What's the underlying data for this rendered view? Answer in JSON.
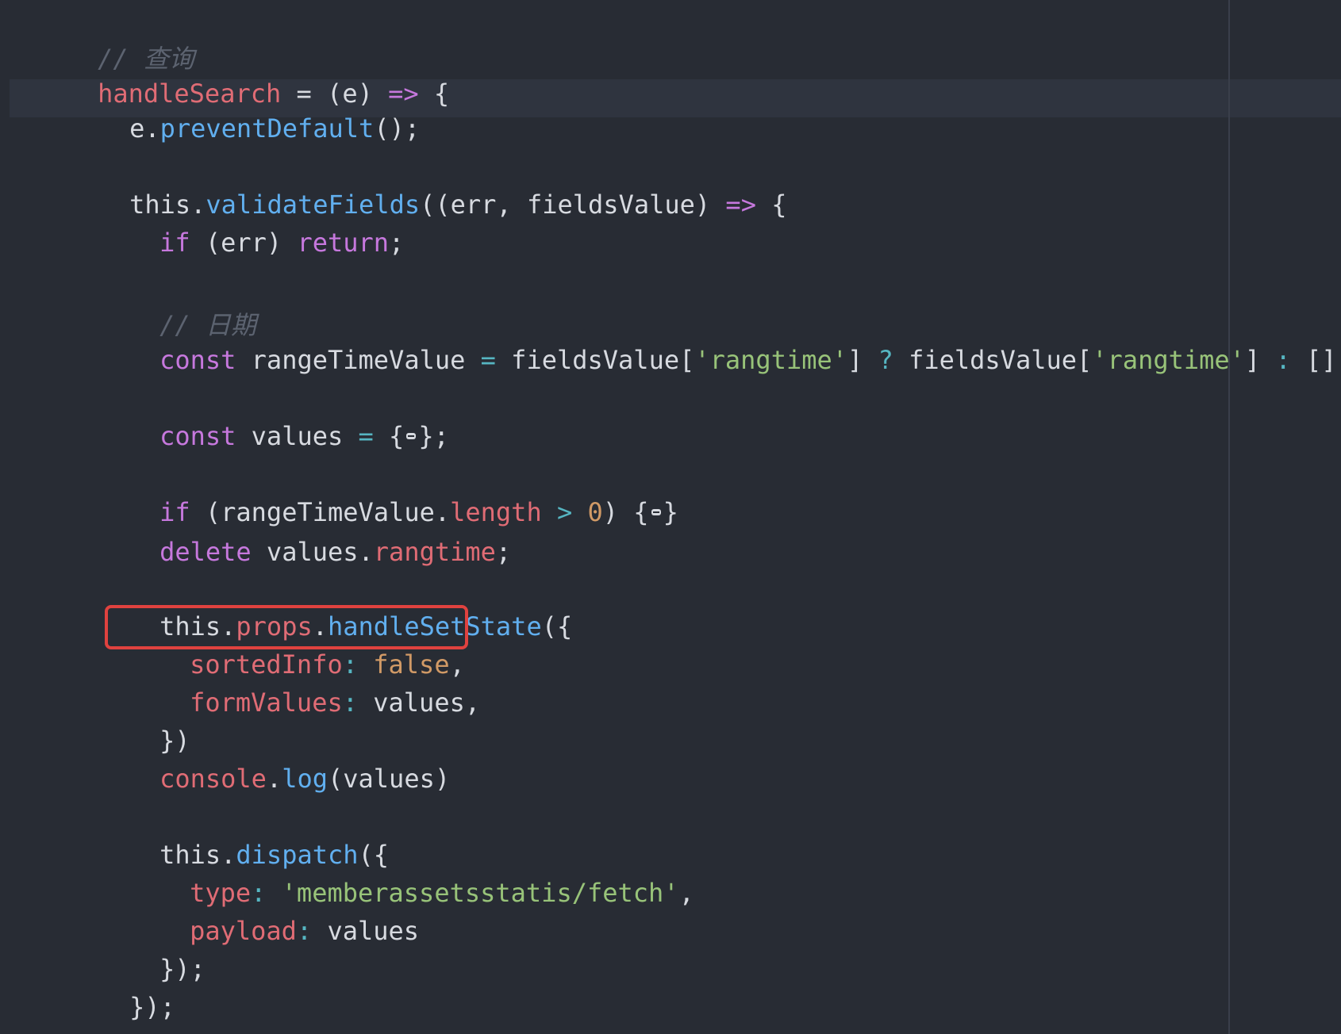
{
  "editor": {
    "theme_colors": {
      "background": "#282c34",
      "current_line": "#2f343f",
      "comment": "#5c6370",
      "keyword": "#c678dd",
      "function_name": "#61afef",
      "identifier_red": "#e06c75",
      "string": "#98c379",
      "number": "#d19a66",
      "operator": "#56b6c2",
      "plain": "#d7dae0",
      "highlight_box": "#e0423f"
    },
    "fold_icon": "fold-ellipsis-icon"
  },
  "code": {
    "comment_query": "// 查询",
    "handleSearch": "handleSearch",
    "assign_arrow": " = (e) ",
    "arrow": "=>",
    "open_brace": " {",
    "indent2": "  ",
    "e": "e.",
    "preventDefault": "preventDefault",
    "call_end": "();",
    "this_dot": "this.",
    "validateFields": "validateFields",
    "validate_args": "((err, fieldsValue) ",
    "if": "if",
    "err_cond": " (err) ",
    "return": "return",
    "semi": ";",
    "comment_date": "// 日期",
    "const": "const",
    "rangeTimeValue_decl": " rangeTimeValue ",
    "eq": "=",
    "fieldsValue_open": " fieldsValue[",
    "rangtime_str": "'rangtime'",
    "bracket_close": "] ",
    "question": "?",
    "colon_op": ":",
    "empty_arr": " [];",
    "values_decl": " values ",
    "brace_open": "{",
    "brace_close_semi": "};",
    "if_range_open": " (rangeTimeValue.",
    "length": "length",
    "gt": ">",
    "zero": "0",
    "paren_close_brace": ") {",
    "brace_close": "}",
    "delete": "delete",
    "values_dot": " values.",
    "rangtime": "rangtime",
    "props": "props",
    "dot": ".",
    "handleSetState": "handleSetState",
    "paren_brace_open": "({",
    "sortedInfo": "sortedInfo",
    "colon": ": ",
    "false": "false",
    "comma": ",",
    "formValues": "formValues",
    "values_comma": "values,",
    "close_obj": "})",
    "console": "console",
    "log": "log",
    "log_args": "(values)",
    "dispatch": "dispatch",
    "type": "type",
    "fetch_str": "'memberassetsstatis/fetch'",
    "payload": "payload",
    "values": "values",
    "close_obj_semi": "});",
    "final_brace": "}"
  }
}
